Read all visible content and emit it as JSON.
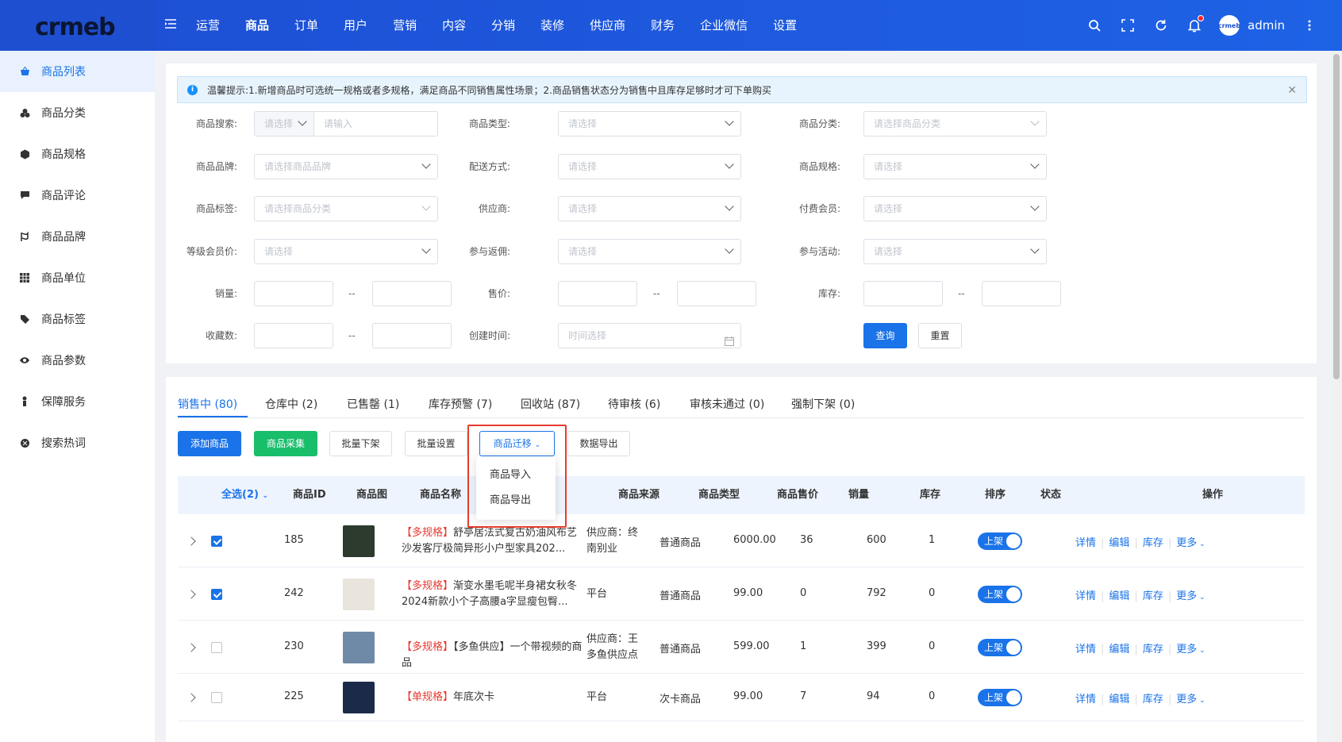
{
  "header": {
    "logo": "crmeb",
    "nav": [
      "运营",
      "商品",
      "订单",
      "用户",
      "营销",
      "内容",
      "分销",
      "装修",
      "供应商",
      "财务",
      "企业微信",
      "设置"
    ],
    "active_nav": "商品",
    "user": "admin",
    "avatar_text": "crmeb",
    "icons": [
      "search-icon",
      "fullscreen-icon",
      "refresh-icon",
      "bell-icon",
      "more-vertical-icon"
    ]
  },
  "sidebar": {
    "items": [
      {
        "label": "商品列表",
        "icon": "basket-icon",
        "active": true
      },
      {
        "label": "商品分类",
        "icon": "category-icon"
      },
      {
        "label": "商品规格",
        "icon": "cube-icon"
      },
      {
        "label": "商品评论",
        "icon": "comment-icon"
      },
      {
        "label": "商品品牌",
        "icon": "brand-icon"
      },
      {
        "label": "商品单位",
        "icon": "grid-icon"
      },
      {
        "label": "商品标签",
        "icon": "tag-icon"
      },
      {
        "label": "商品参数",
        "icon": "eye-icon"
      },
      {
        "label": "保障服务",
        "icon": "shield-icon"
      },
      {
        "label": "搜索热词",
        "icon": "hotword-icon"
      }
    ]
  },
  "notice": {
    "text": "温馨提示:1.新增商品时可选统一规格或者多规格，满足商品不同销售属性场景；2.商品销售状态分为销售中且库存足够时才可下单购买"
  },
  "filters": {
    "search_label": "商品搜索:",
    "search_select": "请选择",
    "search_input": "请输入",
    "type_label": "商品类型:",
    "type_placeholder": "请选择",
    "category_label": "商品分类:",
    "category_placeholder": "请选择商品分类",
    "brand_label": "商品品牌:",
    "brand_placeholder": "请选择商品品牌",
    "delivery_label": "配送方式:",
    "delivery_placeholder": "请选择",
    "spec_label": "商品规格:",
    "spec_placeholder": "请选择",
    "tag_label": "商品标签:",
    "tag_placeholder": "请选择商品分类",
    "supplier_label": "供应商:",
    "supplier_placeholder": "请选择",
    "vip_label": "付费会员:",
    "vip_placeholder": "请选择",
    "level_label": "等级会员价:",
    "level_placeholder": "请选择",
    "rebate_label": "参与返佣:",
    "rebate_placeholder": "请选择",
    "activity_label": "参与活动:",
    "activity_placeholder": "请选择",
    "sales_label": "销量:",
    "price_label": "售价:",
    "stock_label": "库存:",
    "collect_label": "收藏数:",
    "created_label": "创建时间:",
    "created_placeholder": "时间选择",
    "range_sep": "--",
    "query_btn": "查询",
    "reset_btn": "重置"
  },
  "tabs": [
    {
      "label": "销售中 (80)",
      "active": true
    },
    {
      "label": "仓库中 (2)"
    },
    {
      "label": "已售罄 (1)"
    },
    {
      "label": "库存预警 (7)"
    },
    {
      "label": "回收站 (87)"
    },
    {
      "label": "待审核 (6)"
    },
    {
      "label": "审核未通过 (0)"
    },
    {
      "label": "强制下架 (0)"
    }
  ],
  "actions": {
    "add": "添加商品",
    "collect": "商品采集",
    "batch_off": "批量下架",
    "batch_set": "批量设置",
    "migrate": "商品迁移",
    "export": "数据导出"
  },
  "migrate_menu": [
    "商品导入",
    "商品导出"
  ],
  "table": {
    "select_all": "全选(2)",
    "columns": [
      "商品ID",
      "商品图",
      "商品名称",
      "商品来源",
      "商品类型",
      "商品售价",
      "销量",
      "库存",
      "排序",
      "状态",
      "操作"
    ],
    "rows": [
      {
        "id": "185",
        "tag": "【多规格】",
        "name": "舒亭居法式复古奶油风布艺沙发客厅极简异形小户型家具202...",
        "source": "供应商：终南别业",
        "type": "普通商品",
        "price": "6000.00",
        "sales": "36",
        "stock": "600",
        "sort": "1",
        "status": "上架",
        "checked": true,
        "img_color": "#2d3a2e"
      },
      {
        "id": "242",
        "tag": "【多规格】",
        "name": "渐变水墨毛呢半身裙女秋冬2024新款小个子高腰a字显瘦包臀...",
        "source": "平台",
        "type": "普通商品",
        "price": "99.00",
        "sales": "0",
        "stock": "792",
        "sort": "0",
        "status": "上架",
        "checked": true,
        "img_color": "#e9e4dc"
      },
      {
        "id": "230",
        "tag": "【多规格】",
        "name": "【多鱼供应】一个带视频的商品",
        "source": "供应商：王多鱼供应点",
        "type": "普通商品",
        "price": "599.00",
        "sales": "1",
        "stock": "399",
        "sort": "0",
        "status": "上架",
        "checked": false,
        "img_color": "#6f8aa6"
      },
      {
        "id": "225",
        "tag": "【单规格】",
        "name": "年底次卡",
        "source": "平台",
        "type": "次卡商品",
        "price": "99.00",
        "sales": "7",
        "stock": "94",
        "sort": "0",
        "status": "上架",
        "checked": false,
        "img_color": "#1c2a4a"
      }
    ],
    "ops": [
      "详情",
      "编辑",
      "库存",
      "更多"
    ]
  },
  "colors": {
    "primary": "#1a73e8",
    "header": "#1e57dc",
    "green": "#19be6b",
    "highlight": "#e63c2d"
  }
}
